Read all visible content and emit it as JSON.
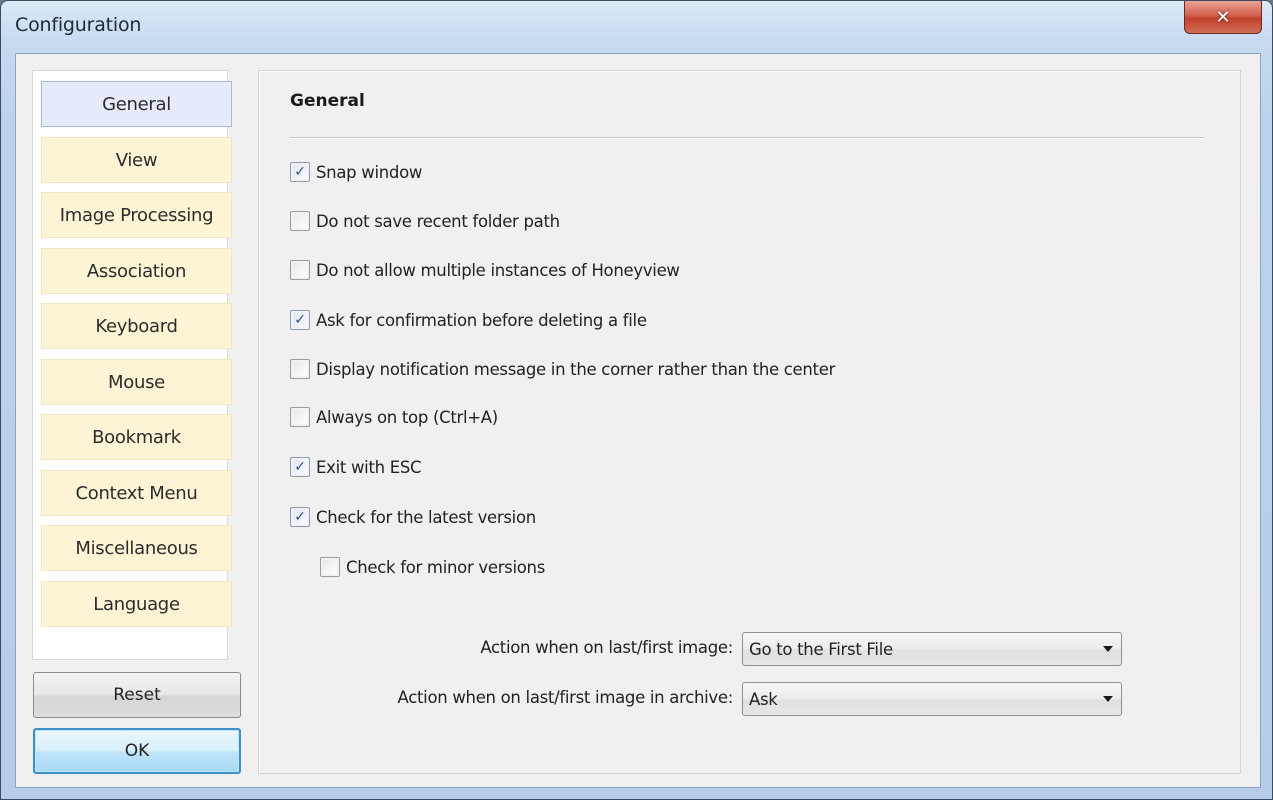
{
  "window": {
    "title": "Configuration",
    "close_icon": "close-x-icon"
  },
  "sidebar": {
    "items": [
      {
        "label": "General",
        "active": true
      },
      {
        "label": "View",
        "active": false
      },
      {
        "label": "Image Processing",
        "active": false
      },
      {
        "label": "Association",
        "active": false
      },
      {
        "label": "Keyboard",
        "active": false
      },
      {
        "label": "Mouse",
        "active": false
      },
      {
        "label": "Bookmark",
        "active": false
      },
      {
        "label": "Context Menu",
        "active": false
      },
      {
        "label": "Miscellaneous",
        "active": false
      },
      {
        "label": "Language",
        "active": false
      }
    ],
    "reset_label": "Reset",
    "ok_label": "OK"
  },
  "main": {
    "section_title": "General",
    "options": [
      {
        "label": "Snap window",
        "checked": true,
        "check_glyph": "✓"
      },
      {
        "label": "Do not save recent folder path",
        "checked": false,
        "check_glyph": ""
      },
      {
        "label": "Do not allow multiple instances of Honeyview",
        "checked": false,
        "check_glyph": ""
      },
      {
        "label": "Ask for confirmation before deleting a file",
        "checked": true,
        "check_glyph": "✓"
      },
      {
        "label": "Display notification message in the corner rather than the center",
        "checked": false,
        "check_glyph": ""
      },
      {
        "label": "Always on top (Ctrl+A)",
        "checked": false,
        "check_glyph": ""
      },
      {
        "label": "Exit with ESC",
        "checked": true,
        "check_glyph": "✓"
      },
      {
        "label": "Check for the latest version",
        "checked": true,
        "check_glyph": "✓"
      },
      {
        "label": "Check for minor versions",
        "checked": false,
        "check_glyph": ""
      }
    ],
    "fields": [
      {
        "label": "Action when on last/first image:",
        "value": "Go to the First File"
      },
      {
        "label": "Action when on last/first image in archive:",
        "value": "Ask"
      }
    ]
  }
}
